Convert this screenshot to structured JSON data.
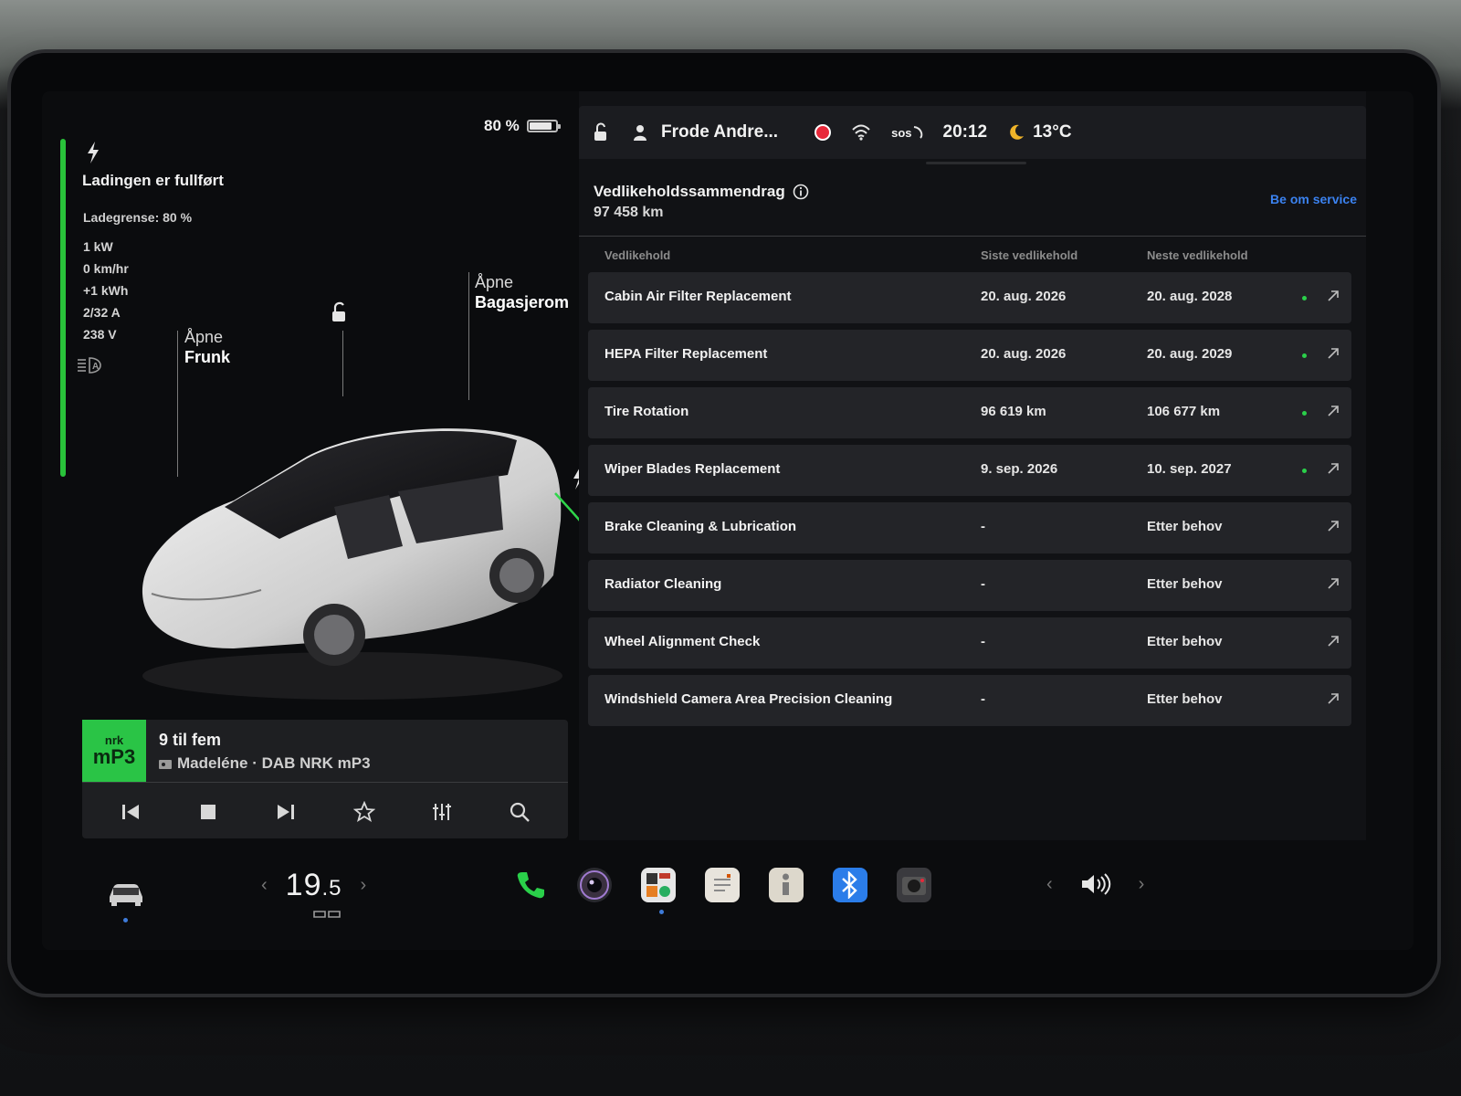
{
  "charging": {
    "title": "Ladingen er fullført",
    "limit": "Ladegrense: 80 %",
    "power": "1 kW",
    "rate": "0 km/hr",
    "energy": "+1 kWh",
    "current": "2/32 A",
    "voltage": "238 V",
    "accent_color": "#29c23a"
  },
  "battery": {
    "percent_label": "80 %",
    "level": 0.8
  },
  "car": {
    "frunk_action": "Åpne",
    "frunk_target": "Frunk",
    "trunk_action": "Åpne",
    "trunk_target": "Bagasjerom"
  },
  "status_bar": {
    "user_name": "Frode Andre...",
    "sos_label": "sos",
    "time": "20:12",
    "temperature": "13°C"
  },
  "maintenance": {
    "title": "Vedlikeholdssammendrag",
    "odometer": "97 458  km",
    "service_link": "Be om service",
    "headers": {
      "item": "Vedlikehold",
      "last": "Siste vedlikehold",
      "next": "Neste vedlikehold"
    },
    "rows": [
      {
        "name": "Cabin Air Filter Replacement",
        "last": "20. aug. 2026",
        "next": "20. aug. 2028",
        "ok": true
      },
      {
        "name": "HEPA Filter Replacement",
        "last": "20. aug. 2026",
        "next": "20. aug. 2029",
        "ok": true
      },
      {
        "name": "Tire Rotation",
        "last": "96 619 km",
        "next": "106 677 km",
        "ok": true
      },
      {
        "name": "Wiper Blades Replacement",
        "last": "9. sep. 2026",
        "next": "10. sep. 2027",
        "ok": true
      },
      {
        "name": "Brake Cleaning & Lubrication",
        "last": "-",
        "next": "Etter behov",
        "ok": false
      },
      {
        "name": "Radiator Cleaning",
        "last": "-",
        "next": "Etter behov",
        "ok": false
      },
      {
        "name": "Wheel Alignment Check",
        "last": "-",
        "next": "Etter behov",
        "ok": false
      },
      {
        "name": "Windshield Camera Area Precision Cleaning",
        "last": "-",
        "next": "Etter behov",
        "ok": false
      }
    ]
  },
  "media": {
    "logo_top": "nrk",
    "logo_bottom": "mP3",
    "title": "9 til fem",
    "subtitle": "Madeléne · DAB NRK mP3"
  },
  "climate": {
    "temperature_whole": "19",
    "temperature_decimal": ".5"
  },
  "icons": {
    "status_ok_color": "#2ad04a",
    "link_color": "#3b82f0",
    "record_color": "#e8283a"
  }
}
